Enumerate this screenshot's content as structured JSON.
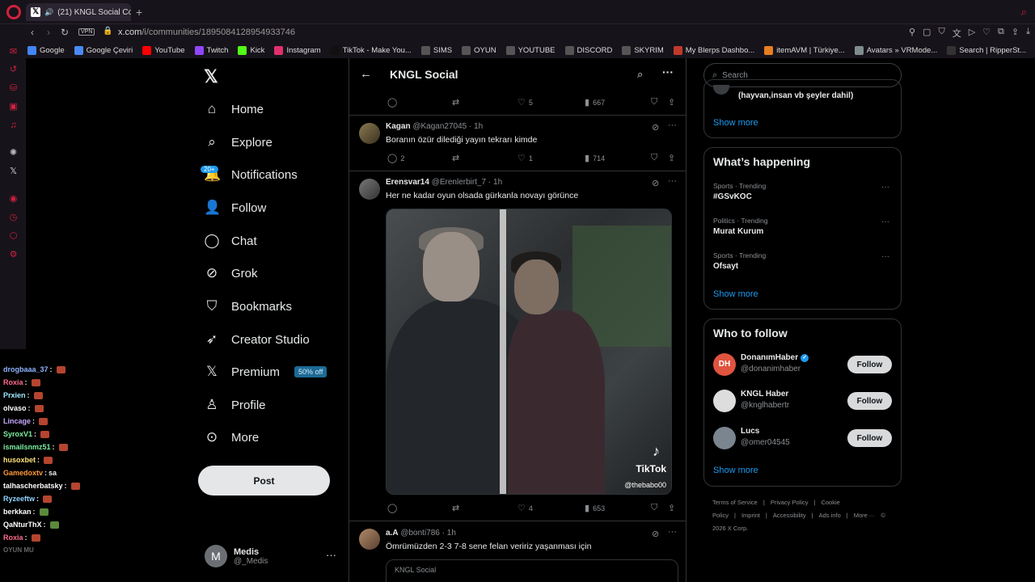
{
  "browser": {
    "tab_title": "(21) KNGL Social Comm",
    "url_host": "x.com",
    "url_path": "/i/communities/1895084128954933746",
    "vpn_label": "VPN",
    "bookmarks": [
      {
        "label": "Google",
        "color": "#4285f4"
      },
      {
        "label": "Google Çeviri",
        "color": "#4a8af4"
      },
      {
        "label": "YouTube",
        "color": "#ff0000"
      },
      {
        "label": "Twitch",
        "color": "#9146ff"
      },
      {
        "label": "Kick",
        "color": "#53fc18"
      },
      {
        "label": "Instagram",
        "color": "#e1306c"
      },
      {
        "label": "TikTok - Make You...",
        "color": "#111111"
      },
      {
        "label": "SIMS",
        "color": "#555555"
      },
      {
        "label": "OYUN",
        "color": "#555555"
      },
      {
        "label": "YOUTUBE",
        "color": "#555555"
      },
      {
        "label": "DISCORD",
        "color": "#555555"
      },
      {
        "label": "SKYRIM",
        "color": "#555555"
      },
      {
        "label": "My Blerps Dashbo...",
        "color": "#c0392b"
      },
      {
        "label": "itemAVM | Türkiye...",
        "color": "#e67e22"
      },
      {
        "label": "Avatars » VRMode...",
        "color": "#7f8c8d"
      },
      {
        "label": "Search | RipperSt...",
        "color": "#333333"
      }
    ]
  },
  "chat": {
    "lines": [
      {
        "user": "drogbaaa_37",
        "color": "#8fb3ff",
        "msg": "",
        "emote": true
      },
      {
        "user": "Roxia",
        "color": "#ff6b8a",
        "msg": "",
        "emote": true
      },
      {
        "user": "Prxien",
        "color": "#9fe8ff",
        "msg": "",
        "emote": true
      },
      {
        "user": "olvaso",
        "color": "#ffffff",
        "msg": "",
        "emote": true
      },
      {
        "user": "Lincage",
        "color": "#c9a8ff",
        "msg": "",
        "emote": true
      },
      {
        "user": "SyroxV1",
        "color": "#7cf0a0",
        "msg": "",
        "emote": true
      },
      {
        "user": "ismailsnmz51",
        "color": "#7cf0a0",
        "msg": "",
        "emote": true
      },
      {
        "user": "husoxbet",
        "color": "#ffe47a",
        "msg": "",
        "emote": true
      },
      {
        "user": "Gamedoxtv",
        "color": "#ff9a3c",
        "msg": "sa",
        "emote": false
      },
      {
        "user": "talhascherbatsky",
        "color": "#ffffff",
        "msg": "",
        "emote": true
      },
      {
        "user": "Ryzeeftw",
        "color": "#8fd3ff",
        "msg": "",
        "emote": true
      },
      {
        "user": "berkkan",
        "color": "#ffffff",
        "msg": "",
        "emote": true
      },
      {
        "user": "QaNturThX",
        "color": "#ffffff",
        "msg": "",
        "emote": true
      },
      {
        "user": "Roxia",
        "color": "#ff6b8a",
        "msg": "",
        "emote": true
      }
    ],
    "faded_line": "OYUN MU"
  },
  "nav": {
    "items": [
      {
        "label": "Home",
        "icon": "home-icon"
      },
      {
        "label": "Explore",
        "icon": "search-icon"
      },
      {
        "label": "Notifications",
        "icon": "bell-icon"
      },
      {
        "label": "Follow",
        "icon": "person-add-icon"
      },
      {
        "label": "Chat",
        "icon": "chat-icon"
      },
      {
        "label": "Grok",
        "icon": "grok-icon"
      },
      {
        "label": "Bookmarks",
        "icon": "bookmark-icon"
      },
      {
        "label": "Creator Studio",
        "icon": "rocket-icon"
      },
      {
        "label": "Premium",
        "icon": "x-logo-icon"
      },
      {
        "label": "Profile",
        "icon": "person-icon"
      },
      {
        "label": "More",
        "icon": "more-circle-icon"
      }
    ],
    "notifications_badge": "20+",
    "premium_badge": "50% off",
    "post_label": "Post",
    "account": {
      "initial": "M",
      "name": "Medis",
      "handle": "@_Medis"
    }
  },
  "community": {
    "title": "KNGL Social",
    "top_actions": {
      "likes": "5",
      "views": "667"
    },
    "tweets": [
      {
        "name": "Kagan",
        "handle": "@Kagan27045",
        "time": "· 1h",
        "text": "Boranın özür dilediği yayın tekrarı kimde",
        "replies": "2",
        "likes": "1",
        "views": "714"
      },
      {
        "name": "Erensvar14",
        "handle": "@Erenlerbirt_7",
        "time": "· 1h",
        "text": "Her ne kadar oyun olsada gürkanla novayı görünce",
        "replies": "",
        "likes": "4",
        "views": "653",
        "media": {
          "watermark": "TikTok",
          "watermark_user": "@thebabo00"
        }
      },
      {
        "name": "a.A",
        "handle": "@bonti786",
        "time": "· 1h",
        "text": "Ömrümüzden 2-3 7-8 sene felan  veririz yaşanması için",
        "quote_community": "KNGL Social"
      }
    ]
  },
  "sidebar": {
    "search_placeholder": "Search",
    "top_card_text": "(hayvan,insan vb şeyler dahil)",
    "show_more": "Show more",
    "whats_happening": "What’s happening",
    "trends": [
      {
        "meta": "Sports · Trending",
        "name": "#GSvKOC"
      },
      {
        "meta": "Politics · Trending",
        "name": "Murat Kurum"
      },
      {
        "meta": "Sports · Trending",
        "name": "Ofsayt"
      }
    ],
    "who_to_follow": "Who to follow",
    "follow_label": "Follow",
    "suggestions": [
      {
        "name": "DonanımHaber",
        "handle": "@donanimhaber",
        "verified": true,
        "avatar_color": "#e0533f",
        "initials": "DH"
      },
      {
        "name": "KNGL Haber",
        "handle": "@knglhabertr",
        "verified": false,
        "avatar_color": "#dddddd",
        "initials": ""
      },
      {
        "name": "Lucs",
        "handle": "@omer04545",
        "verified": false,
        "avatar_color": "#7a8590",
        "initials": ""
      }
    ],
    "footer": [
      "Terms of Service",
      "|",
      "Privacy Policy",
      "|",
      "Cookie Policy",
      "|",
      "Imprint",
      "|",
      "Accessibility",
      "|",
      "Ads info",
      "|",
      "More ···",
      "© 2026 X Corp."
    ]
  }
}
